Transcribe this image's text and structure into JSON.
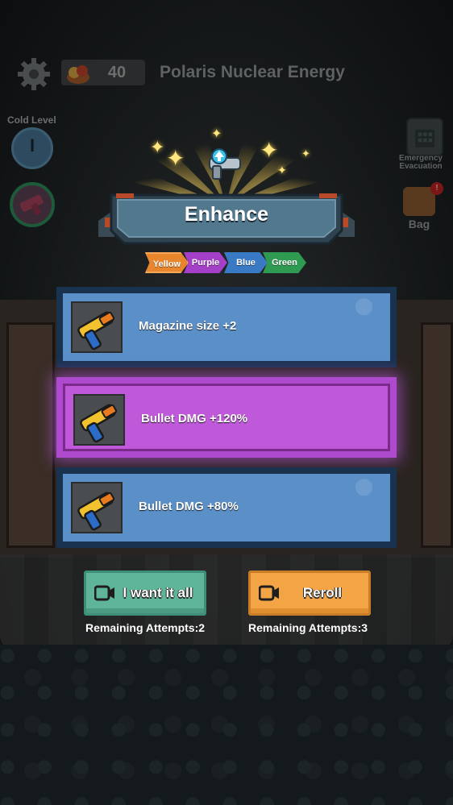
{
  "hud": {
    "coins": "40",
    "level_name": "Polaris Nuclear Energy",
    "cold_level_label": "Cold Level",
    "cold_level_value": "I",
    "evacuation_label_line1": "Emergency",
    "evacuation_label_line2": "Evacuation",
    "bag_label": "Bag",
    "bag_badge": "!"
  },
  "enhance": {
    "title": "Enhance",
    "rarity_tags": [
      "Yellow",
      "Purple",
      "Blue",
      "Green"
    ]
  },
  "options": [
    {
      "icon": "yellow-pistol-icon",
      "text": "Magazine size +2",
      "rarity": "blue"
    },
    {
      "icon": "yellow-pistol-icon",
      "text": "Bullet DMG +120%",
      "rarity": "purple"
    },
    {
      "icon": "yellow-pistol-icon",
      "text": "Bullet DMG +80%",
      "rarity": "blue"
    }
  ],
  "actions": {
    "want_all_label": "I want it all",
    "want_all_attempts": "Remaining Attempts:2",
    "reroll_label": "Reroll",
    "reroll_attempts": "Remaining Attempts:3"
  },
  "colors": {
    "blue_card": "#5a8fc8",
    "purple_card": "#bf59d9",
    "green_button": "#5fb59a",
    "orange_button": "#f3a444"
  }
}
